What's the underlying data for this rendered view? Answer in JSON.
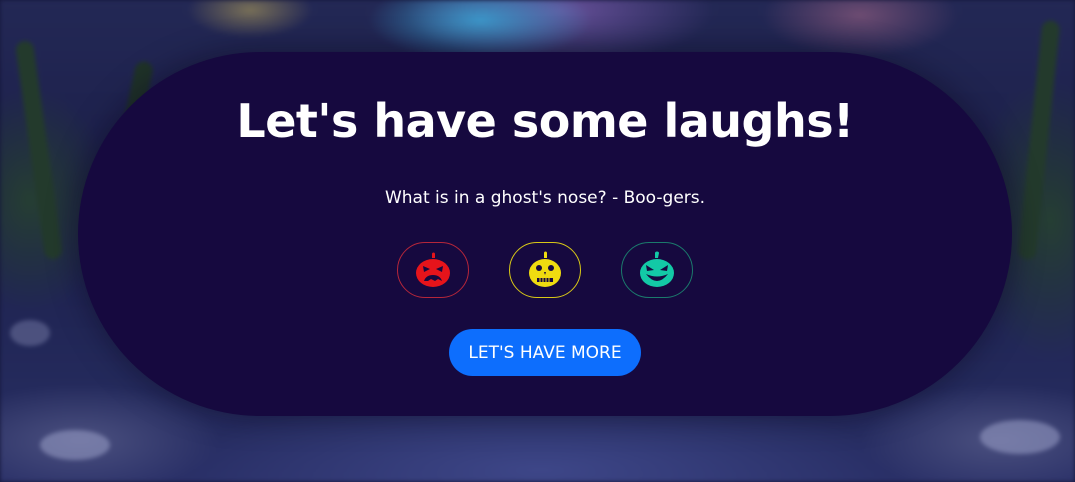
{
  "page": {
    "title": "Let's have some laughs!",
    "joke": "What is in a ghost's nose? - Boo-gers."
  },
  "ratings": [
    {
      "name": "angry-pumpkin",
      "color": "#e6141b",
      "border": "#b5263a"
    },
    {
      "name": "neutral-pumpkin",
      "color": "#efdc10",
      "border": "#d8c817"
    },
    {
      "name": "laughing-pumpkin",
      "color": "#13c9a6",
      "border": "#1b7a6c"
    }
  ],
  "actions": {
    "more_label": "LET'S HAVE MORE"
  },
  "colors": {
    "panel": "#16093f",
    "button": "#0d6efd"
  }
}
